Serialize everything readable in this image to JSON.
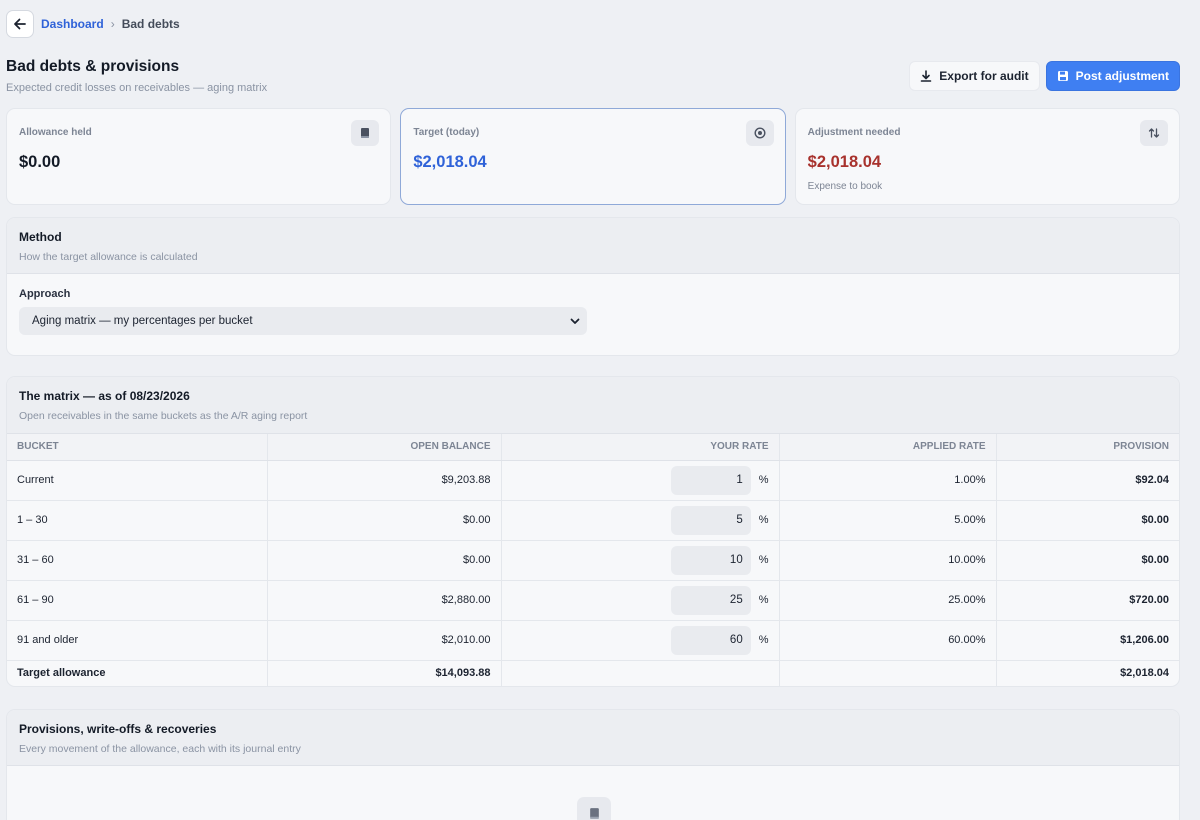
{
  "breadcrumb": {
    "parent": "Dashboard",
    "current": "Bad debts",
    "separator": "›"
  },
  "page": {
    "title": "Bad debts & provisions",
    "subtitle": "Expected credit losses on receivables — aging matrix",
    "export_label": "Export for audit",
    "post_label": "Post adjustment"
  },
  "stats": [
    {
      "label": "Allowance held",
      "value": "$0.00",
      "note": "",
      "color": "#131a26",
      "icon": "book-icon"
    },
    {
      "label": "Target (today)",
      "value": "$2,018.04",
      "note": "",
      "color": "#2f62d8",
      "icon": "target-icon"
    },
    {
      "label": "Adjustment needed",
      "value": "$2,018.04",
      "note": "Expense to book",
      "color": "#a8322d",
      "icon": "swap-vertical-icon"
    }
  ],
  "method": {
    "title": "Method",
    "subtitle": "How the target allowance is calculated",
    "field_label": "Approach",
    "selected": "Aging matrix — my percentages per bucket"
  },
  "matrix": {
    "title": "The matrix — as of 08/23/2026",
    "subtitle": "Open receivables in the same buckets as the A/R aging report",
    "columns": [
      "BUCKET",
      "OPEN BALANCE",
      "YOUR RATE",
      "APPLIED RATE",
      "PROVISION"
    ],
    "rate_unit": "%",
    "rows": [
      {
        "bucket": "Current",
        "balance": "$9,203.88",
        "rate": "1",
        "applied": "1.00%",
        "provision": "$92.04"
      },
      {
        "bucket": "1 – 30",
        "balance": "$0.00",
        "rate": "5",
        "applied": "5.00%",
        "provision": "$0.00"
      },
      {
        "bucket": "31 – 60",
        "balance": "$0.00",
        "rate": "10",
        "applied": "10.00%",
        "provision": "$0.00"
      },
      {
        "bucket": "61 – 90",
        "balance": "$2,880.00",
        "rate": "25",
        "applied": "25.00%",
        "provision": "$720.00"
      },
      {
        "bucket": "91 and older",
        "balance": "$2,010.00",
        "rate": "60",
        "applied": "60.00%",
        "provision": "$1,206.00"
      }
    ],
    "total": {
      "label": "Target allowance",
      "balance": "$14,093.88",
      "provision": "$2,018.04"
    }
  },
  "movements": {
    "title": "Provisions, write-offs & recoveries",
    "subtitle": "Every movement of the allowance, each with its journal entry"
  },
  "colors": {
    "accent": "#3f7ff2",
    "link": "#2f62d8",
    "negative": "#a8322d"
  }
}
